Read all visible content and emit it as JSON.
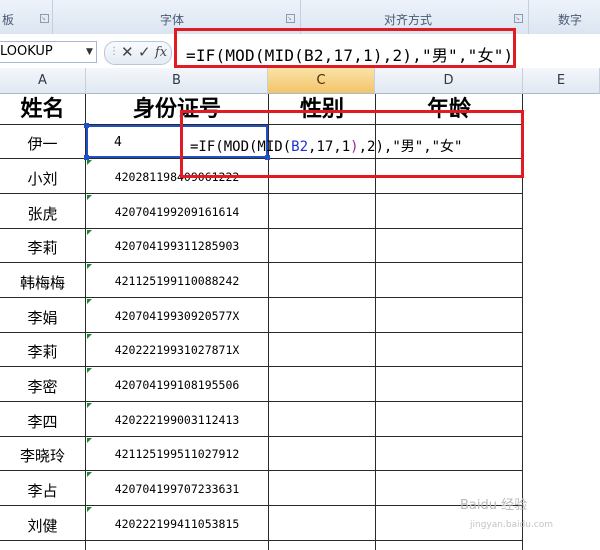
{
  "ribbon": {
    "groups": [
      {
        "label": "板"
      },
      {
        "label": "字体"
      },
      {
        "label": "对齐方式"
      },
      {
        "label": "数字"
      }
    ]
  },
  "formula_bar": {
    "name_box": "LOOKUP",
    "cancel": "✕",
    "enter": "✓",
    "fx": "fx",
    "formula": "=IF(MOD(MID(B2,17,1),2),\"男\",\"女\")"
  },
  "columns": [
    "A",
    "B",
    "C",
    "D",
    "E"
  ],
  "headers": {
    "a": "姓名",
    "b": "身份证号",
    "c": "性别",
    "d": "年龄"
  },
  "in_cell": {
    "value_b2": "4",
    "p1": "=IF(MOD(MID(",
    "ref": "B2",
    "p2": ",17,1",
    "p3": ")",
    "p4": ",2)",
    "p5": ",\"男\",\"女\""
  },
  "rows": [
    {
      "name": "伊一",
      "id": ""
    },
    {
      "name": "小刘",
      "id": "420281198409061222"
    },
    {
      "name": "张虎",
      "id": "420704199209161614"
    },
    {
      "name": "李莉",
      "id": "420704199311285903"
    },
    {
      "name": "韩梅梅",
      "id": "421125199110088242"
    },
    {
      "name": "李娟",
      "id": "42070419930920577X"
    },
    {
      "name": "李莉",
      "id": "42022219931027871X"
    },
    {
      "name": "李密",
      "id": "420704199108195506"
    },
    {
      "name": "李四",
      "id": "420222199003112413"
    },
    {
      "name": "李晓玲",
      "id": "421125199511027912"
    },
    {
      "name": "李占",
      "id": "420704199707233631"
    },
    {
      "name": "刘健",
      "id": "420222199411053815"
    }
  ],
  "watermark": {
    "line1": "Baidu 经验",
    "line2": "jingyan.baidu.com"
  },
  "colors": {
    "highlight": "#e01b24",
    "selection": "#2050c8",
    "ref": "#1f2fd0"
  }
}
